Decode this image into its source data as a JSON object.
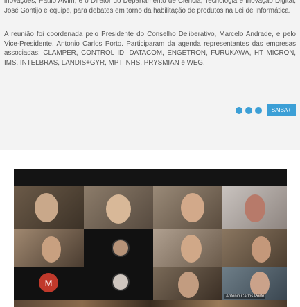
{
  "article": {
    "paragraph_1": "inovações, Paulo Alvim, e o Diretor do Departamento de Ciência, Tecnologia e Inovação Digital, José Gontijo e equipe, para debates em torno da habilitação de produtos na Lei de Informática.",
    "paragraph_2": "A reunião foi coordenada pelo Presidente do Conselho Deliberativo, Marcelo Andrade, e pelo Vice-Presidente, Antonio Carlos Porto. Participaram da agenda representantes das empresas associadas: CLAMPER, CONTROL ID, DATACOM, ENGETRON, FURUKAWA, HT MICRON, IMS, INTELBRAS, LANDIS+GYR, MPT, NHS, PRYSMIAN e WEG.",
    "more_label": "SAIBA+"
  },
  "video_call": {
    "participant_initial": "M",
    "name_tag": "Antonio Carlos Porto"
  },
  "colors": {
    "accent": "#3c9fd6",
    "initial_avatar": "#c0392b"
  }
}
